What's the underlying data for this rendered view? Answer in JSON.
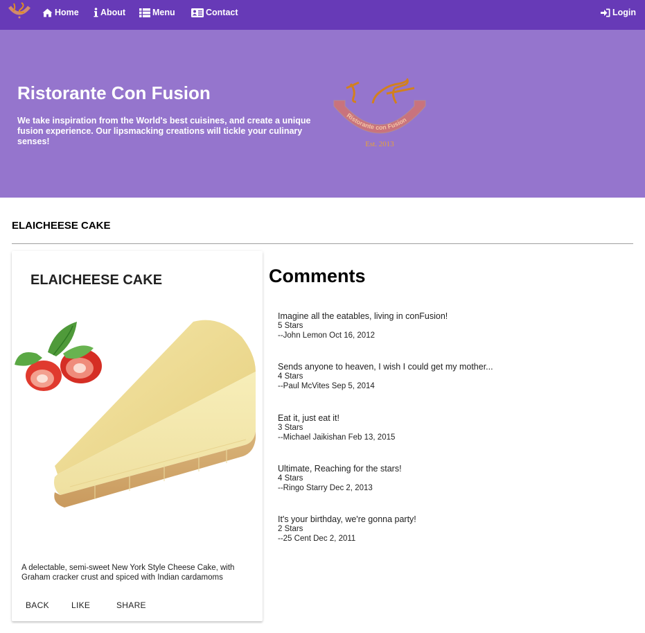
{
  "nav": {
    "items": [
      {
        "label": "Home",
        "icon": "home-icon"
      },
      {
        "label": "About",
        "icon": "info-icon"
      },
      {
        "label": "Menu",
        "icon": "list-icon"
      },
      {
        "label": "Contact",
        "icon": "address-card-icon"
      }
    ],
    "login_label": "Login"
  },
  "jumbotron": {
    "title": "Ristorante Con Fusion",
    "text": "We take inspiration from the World's best cuisines, and create a unique fusion experience. Our lipsmacking creations will tickle your culinary senses!",
    "logo_text": "Ristorante con Fusion",
    "logo_est": "Est. 2013"
  },
  "page_heading": "ELAICHEESE CAKE",
  "dish": {
    "name": "ELAICHEESE CAKE",
    "description": "A delectable, semi-sweet New York Style Cheese Cake, with Graham cracker crust and spiced with Indian cardamoms",
    "buttons": {
      "back": "BACK",
      "like": "LIKE",
      "share": "SHARE"
    }
  },
  "comments": {
    "title": "Comments",
    "items": [
      {
        "text": "Imagine all the eatables, living in conFusion!",
        "rating": "5 Stars",
        "author": "--John Lemon Oct 16, 2012"
      },
      {
        "text": "Sends anyone to heaven, I wish I could get my mother...",
        "rating": "4 Stars",
        "author": "--Paul McVites Sep 5, 2014"
      },
      {
        "text": "Eat it, just eat it!",
        "rating": "3 Stars",
        "author": "--Michael Jaikishan Feb 13, 2015"
      },
      {
        "text": "Ultimate, Reaching for the stars!",
        "rating": "4 Stars",
        "author": "--Ringo Starry Dec 2, 2013"
      },
      {
        "text": "It's your birthday, we're gonna party!",
        "rating": "2 Stars",
        "author": "--25 Cent Dec 2, 2011"
      }
    ]
  },
  "colors": {
    "primary": "#673ab7",
    "primary_light": "#9575cd",
    "text": "#212121"
  }
}
